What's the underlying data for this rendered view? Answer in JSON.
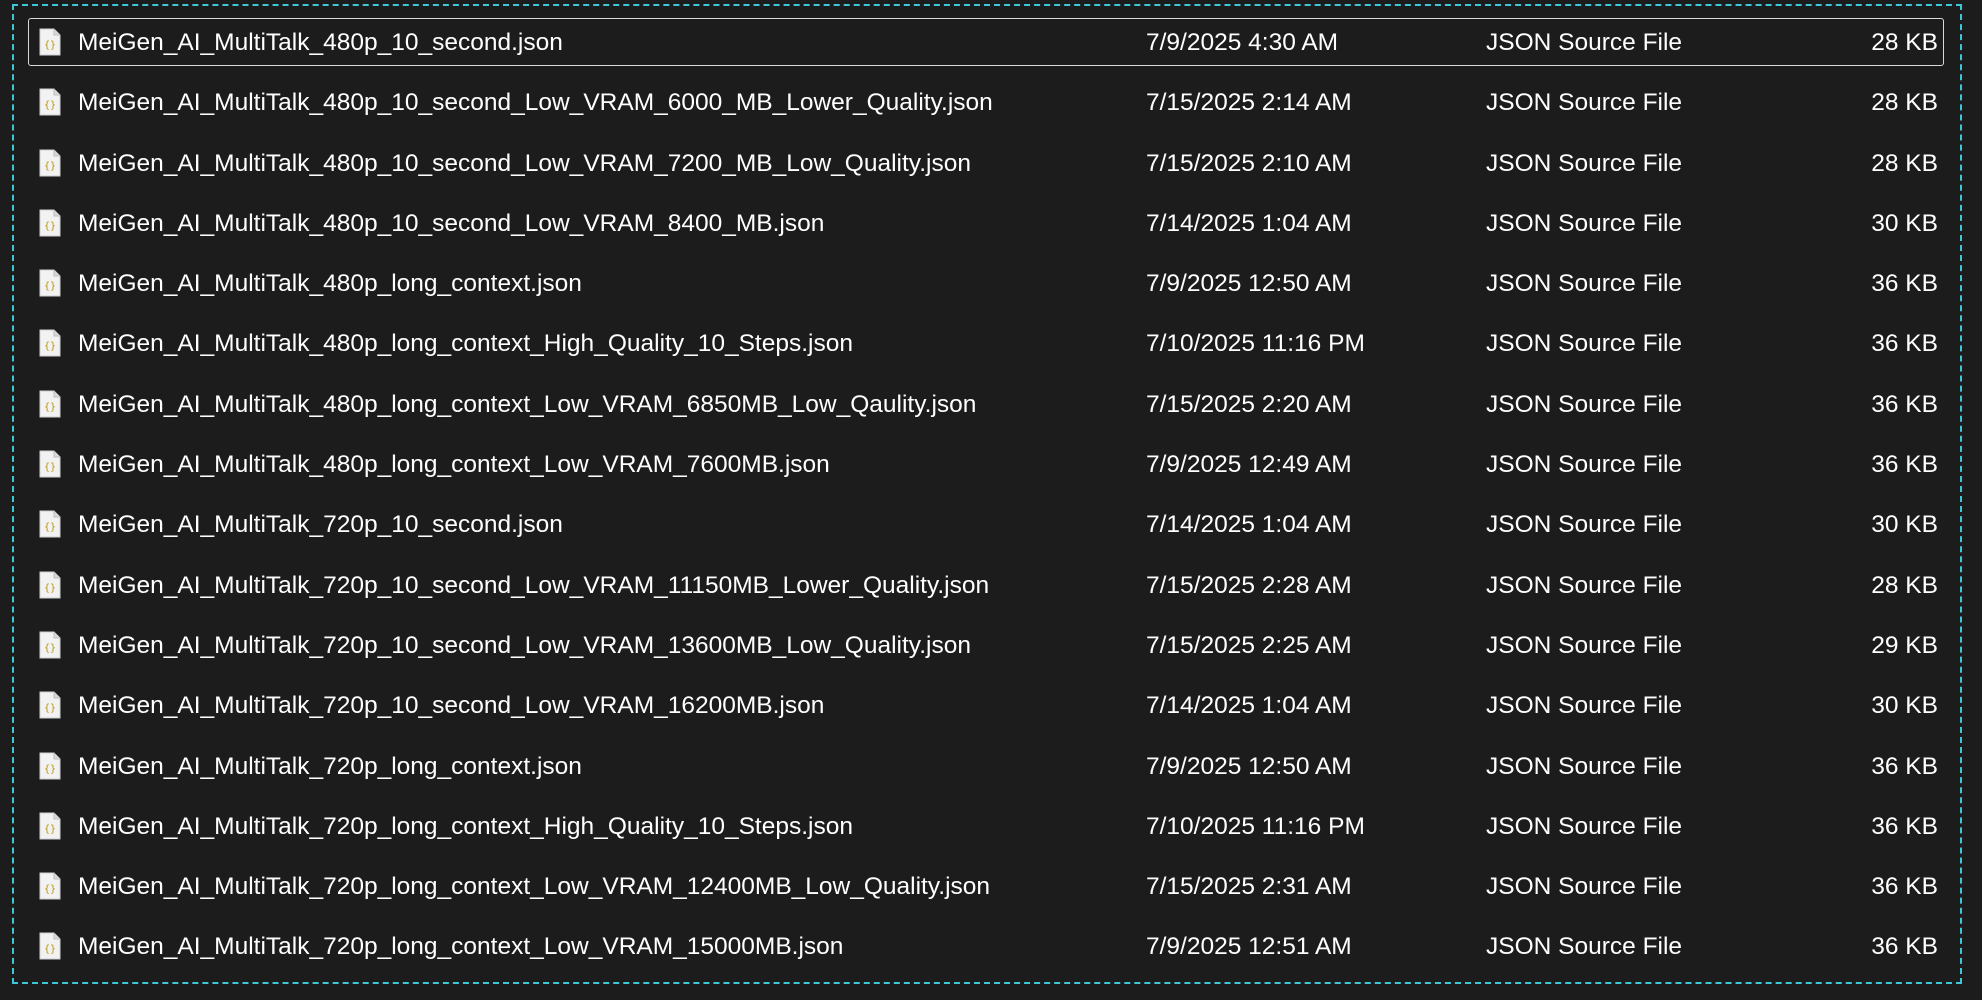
{
  "file_list": {
    "selection_color": "#3ec7d6",
    "rows": [
      {
        "name": "MeiGen_AI_MultiTalk_480p_10_second.json",
        "date": "7/9/2025 4:30 AM",
        "type": "JSON Source File",
        "size": "28 KB",
        "selected": true,
        "icon": "json-file-icon"
      },
      {
        "name": "MeiGen_AI_MultiTalk_480p_10_second_Low_VRAM_6000_MB_Lower_Quality.json",
        "date": "7/15/2025 2:14 AM",
        "type": "JSON Source File",
        "size": "28 KB",
        "icon": "json-file-icon"
      },
      {
        "name": "MeiGen_AI_MultiTalk_480p_10_second_Low_VRAM_7200_MB_Low_Quality.json",
        "date": "7/15/2025 2:10 AM",
        "type": "JSON Source File",
        "size": "28 KB",
        "icon": "json-file-icon"
      },
      {
        "name": "MeiGen_AI_MultiTalk_480p_10_second_Low_VRAM_8400_MB.json",
        "date": "7/14/2025 1:04 AM",
        "type": "JSON Source File",
        "size": "30 KB",
        "icon": "json-file-icon"
      },
      {
        "name": "MeiGen_AI_MultiTalk_480p_long_context.json",
        "date": "7/9/2025 12:50 AM",
        "type": "JSON Source File",
        "size": "36 KB",
        "icon": "json-file-icon"
      },
      {
        "name": "MeiGen_AI_MultiTalk_480p_long_context_High_Quality_10_Steps.json",
        "date": "7/10/2025 11:16 PM",
        "type": "JSON Source File",
        "size": "36 KB",
        "icon": "json-file-icon"
      },
      {
        "name": "MeiGen_AI_MultiTalk_480p_long_context_Low_VRAM_6850MB_Low_Qaulity.json",
        "date": "7/15/2025 2:20 AM",
        "type": "JSON Source File",
        "size": "36 KB",
        "icon": "json-file-icon"
      },
      {
        "name": "MeiGen_AI_MultiTalk_480p_long_context_Low_VRAM_7600MB.json",
        "date": "7/9/2025 12:49 AM",
        "type": "JSON Source File",
        "size": "36 KB",
        "icon": "json-file-icon"
      },
      {
        "name": "MeiGen_AI_MultiTalk_720p_10_second.json",
        "date": "7/14/2025 1:04 AM",
        "type": "JSON Source File",
        "size": "30 KB",
        "icon": "json-file-icon"
      },
      {
        "name": "MeiGen_AI_MultiTalk_720p_10_second_Low_VRAM_11150MB_Lower_Quality.json",
        "date": "7/15/2025 2:28 AM",
        "type": "JSON Source File",
        "size": "28 KB",
        "icon": "json-file-icon"
      },
      {
        "name": "MeiGen_AI_MultiTalk_720p_10_second_Low_VRAM_13600MB_Low_Quality.json",
        "date": "7/15/2025 2:25 AM",
        "type": "JSON Source File",
        "size": "29 KB",
        "icon": "json-file-icon"
      },
      {
        "name": "MeiGen_AI_MultiTalk_720p_10_second_Low_VRAM_16200MB.json",
        "date": "7/14/2025 1:04 AM",
        "type": "JSON Source File",
        "size": "30 KB",
        "icon": "json-file-icon"
      },
      {
        "name": "MeiGen_AI_MultiTalk_720p_long_context.json",
        "date": "7/9/2025 12:50 AM",
        "type": "JSON Source File",
        "size": "36 KB",
        "icon": "json-file-icon"
      },
      {
        "name": "MeiGen_AI_MultiTalk_720p_long_context_High_Quality_10_Steps.json",
        "date": "7/10/2025 11:16 PM",
        "type": "JSON Source File",
        "size": "36 KB",
        "icon": "json-file-icon"
      },
      {
        "name": "MeiGen_AI_MultiTalk_720p_long_context_Low_VRAM_12400MB_Low_Quality.json",
        "date": "7/15/2025 2:31 AM",
        "type": "JSON Source File",
        "size": "36 KB",
        "icon": "json-file-icon"
      },
      {
        "name": "MeiGen_AI_MultiTalk_720p_long_context_Low_VRAM_15000MB.json",
        "date": "7/9/2025 12:51 AM",
        "type": "JSON Source File",
        "size": "36 KB",
        "icon": "json-file-icon"
      }
    ]
  }
}
